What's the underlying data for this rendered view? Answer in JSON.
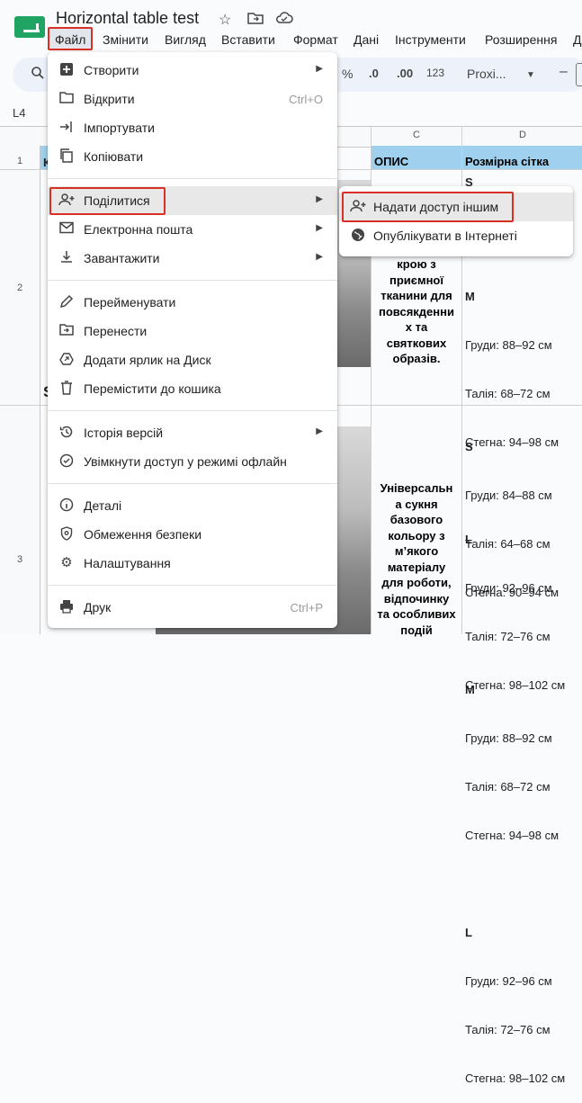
{
  "app": {
    "title": "Horizontal table test",
    "icons": [
      "star-icon",
      "move-folder-icon",
      "cloud-status-icon"
    ]
  },
  "menubar": [
    "Файл",
    "Змінити",
    "Вигляд",
    "Вставити",
    "Формат",
    "Дані",
    "Інструменти",
    "Розширення",
    "Д"
  ],
  "toolbar": {
    "percent": "%",
    "dec_decrease": ".0",
    "dec_increase": ".00",
    "number_format": "123",
    "font": "Proxi...",
    "minus": "–"
  },
  "formula_bar": {
    "cell_ref": "L4"
  },
  "grid": {
    "columns": [
      "C",
      "D"
    ],
    "rows": [
      "1",
      "2",
      "3"
    ],
    "header": {
      "c": "ОПИС",
      "d": "Розмірна сітка",
      "a_fragment": "К"
    },
    "row2": {
      "a_fragment": "S",
      "c_lines": [
        "крою з",
        "приємної",
        "тканини для",
        "повсякденни",
        "х та",
        "святкових",
        "образів."
      ],
      "d_lines": [
        "S",
        "M",
        "Груди: 88–92 см",
        "Талія: 68–72 см",
        "Стегна: 94–98 см",
        "",
        "L",
        "Груди: 92–96 см",
        "Талія: 72–76 см",
        "Стегна: 98–102 см"
      ]
    },
    "row3": {
      "c_lines": [
        "Універсальн",
        "а сукня",
        "базового",
        "кольору з",
        "м’якого",
        "матеріалу",
        "для роботи,",
        "відпочинку",
        "та особливих",
        "подій"
      ],
      "d_lines": [
        "S",
        "Груди: 84–88 см",
        "Талія: 64–68 см",
        "Стегна: 90–94 см",
        "",
        "M",
        "Груди: 88–92 см",
        "Талія: 68–72 см",
        "Стегна: 94–98 см",
        "",
        "L",
        "Груди: 92–96 см",
        "Талія: 72–76 см",
        "Стегна: 98–102 см"
      ]
    }
  },
  "file_menu": {
    "items": [
      {
        "label": "Створити",
        "icon": "add-box-icon",
        "submenu": true
      },
      {
        "label": "Відкрити",
        "icon": "folder-icon",
        "shortcut": "Ctrl+O"
      },
      {
        "label": "Імпортувати",
        "icon": "import-icon"
      },
      {
        "label": "Копіювати",
        "icon": "copy-icon"
      },
      {
        "label": "Поділитися",
        "icon": "person-add-icon",
        "submenu": true
      },
      {
        "label": "Електронна пошта",
        "icon": "mail-icon",
        "submenu": true
      },
      {
        "label": "Завантажити",
        "icon": "download-icon",
        "submenu": true
      },
      {
        "label": "Перейменувати",
        "icon": "pencil-icon"
      },
      {
        "label": "Перенести",
        "icon": "move-folder-icon"
      },
      {
        "label": "Додати ярлик на Диск",
        "icon": "drive-shortcut-icon"
      },
      {
        "label": "Перемістити до кошика",
        "icon": "trash-icon"
      },
      {
        "label": "Історія версій",
        "icon": "history-icon",
        "submenu": true
      },
      {
        "label": "Увімкнути доступ у режимі офлайн",
        "icon": "offline-icon"
      },
      {
        "label": "Деталі",
        "icon": "info-icon"
      },
      {
        "label": "Обмеження безпеки",
        "icon": "security-icon"
      },
      {
        "label": "Налаштування",
        "icon": "settings-icon"
      },
      {
        "label": "Друк",
        "icon": "print-icon",
        "shortcut": "Ctrl+P"
      }
    ]
  },
  "share_submenu": {
    "items": [
      {
        "label": "Надати доступ іншим",
        "icon": "person-add-icon"
      },
      {
        "label": "Опублікувати в Інтернеті",
        "icon": "globe-icon"
      }
    ]
  },
  "colors": {
    "header_fill": "#9fd1ee",
    "highlight_border": "#d93025",
    "logo": "#1fa463"
  }
}
